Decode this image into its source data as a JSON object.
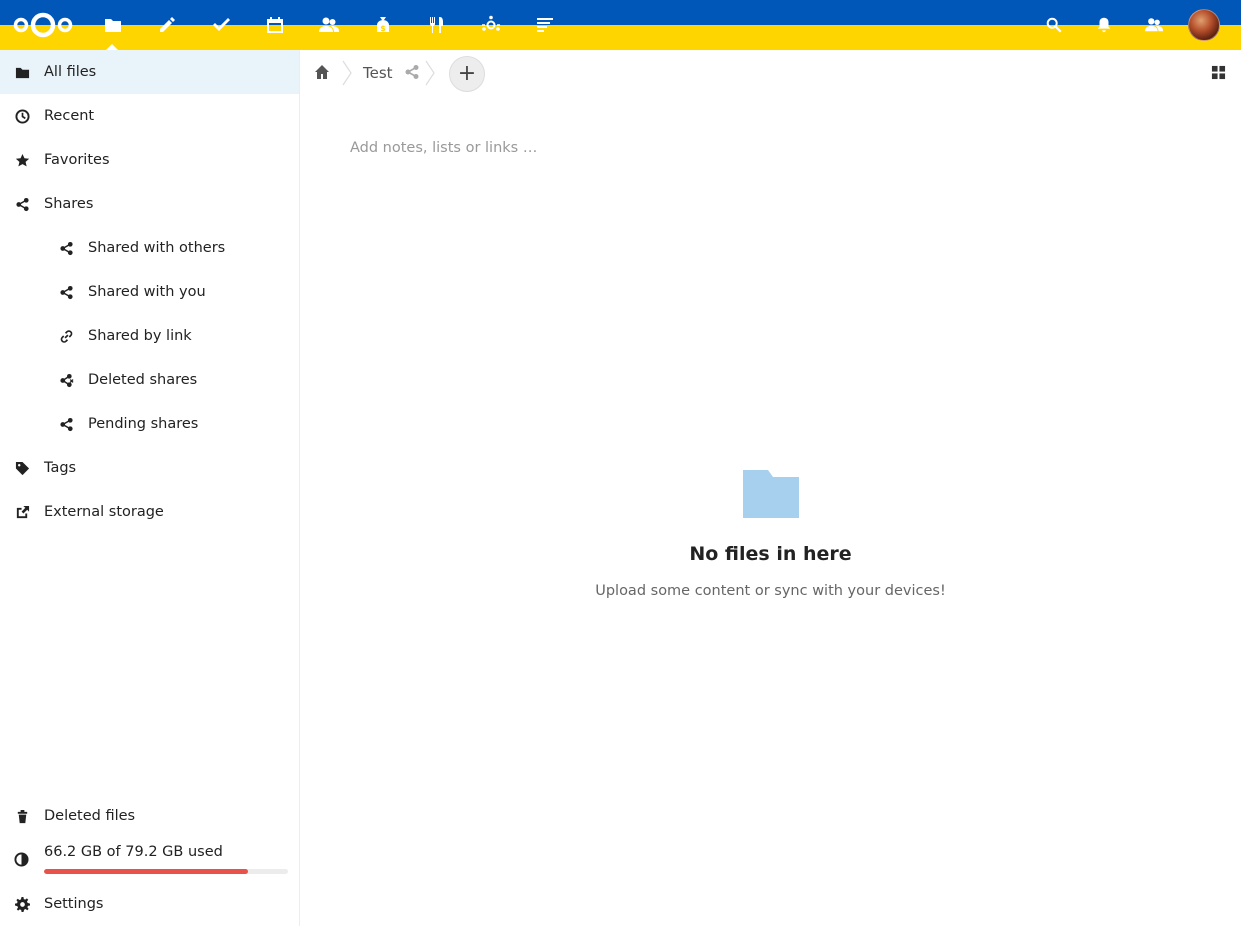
{
  "header": {
    "apps": [
      {
        "name": "files-app-icon",
        "label": "Files"
      },
      {
        "name": "notes-app-icon",
        "label": "Notes"
      },
      {
        "name": "tasks-app-icon",
        "label": "Tasks"
      },
      {
        "name": "calendar-app-icon",
        "label": "Calendar"
      },
      {
        "name": "contacts-app-icon",
        "label": "Contacts"
      },
      {
        "name": "cospend-app-icon",
        "label": "Cospend"
      },
      {
        "name": "cookbook-app-icon",
        "label": "Cookbook"
      },
      {
        "name": "circles-app-icon",
        "label": "Circles"
      },
      {
        "name": "activity-app-icon",
        "label": "Activity"
      }
    ],
    "icons": [
      "search-icon",
      "bell-icon",
      "contacts-icon",
      "avatar"
    ],
    "colors": {
      "top": "#0057b7",
      "bottom": "#ffd500"
    }
  },
  "sidebar": {
    "all_files": "All files",
    "recent": "Recent",
    "favorites": "Favorites",
    "shares": "Shares",
    "shared_with_others": "Shared with others",
    "shared_with_you": "Shared with you",
    "shared_by_link": "Shared by link",
    "deleted_shares": "Deleted shares",
    "pending_shares": "Pending shares",
    "tags": "Tags",
    "external_storage": "External storage",
    "deleted_files": "Deleted files",
    "quota_text": "66.2 GB of 79.2 GB used",
    "quota_fraction": 0.836,
    "settings": "Settings"
  },
  "breadcrumb": {
    "current": "Test"
  },
  "main": {
    "notes_placeholder": "Add notes, lists or links …",
    "empty_title": "No files in here",
    "empty_desc": "Upload some content or sync with your devices!"
  }
}
